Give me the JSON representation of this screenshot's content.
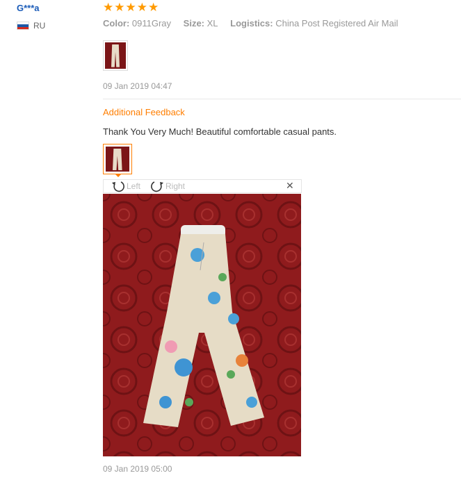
{
  "reviewer": {
    "name": "G***a",
    "country": "RU",
    "flag_colors": [
      "#ffffff",
      "#1c57a5",
      "#d52b1e"
    ]
  },
  "review": {
    "stars": 5,
    "star_glyph": "★",
    "attributes": [
      {
        "key": "Color:",
        "value": "0911Gray"
      },
      {
        "key": "Size:",
        "value": "XL"
      },
      {
        "key": "Logistics:",
        "value": "China Post Registered Air Mail"
      }
    ],
    "date": "09 Jan 2019 04:47"
  },
  "additional": {
    "heading": "Additional Feedback",
    "text": "Thank You Very Much! Beautiful comfortable casual pants.",
    "date": "09 Jan 2019 05:00"
  },
  "viewer": {
    "rotate_left_label": "Left",
    "rotate_right_label": "Right",
    "close_glyph": "✕"
  },
  "colors": {
    "accent": "#ff7e00",
    "star": "#ff9a00",
    "name_link": "#1a5bb8",
    "rug": "#8b1a1c"
  }
}
